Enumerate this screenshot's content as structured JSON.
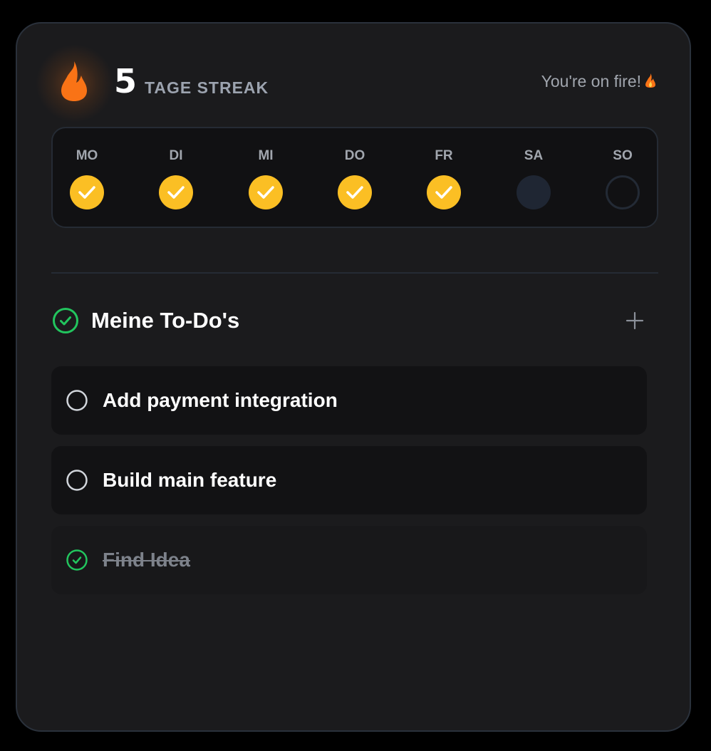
{
  "streak": {
    "count": "5",
    "label": "TAGE STREAK",
    "message": "You're on fire!",
    "icon": "flame-icon"
  },
  "week": {
    "days": [
      {
        "label": "MO",
        "status": "done"
      },
      {
        "label": "DI",
        "status": "done"
      },
      {
        "label": "MI",
        "status": "done"
      },
      {
        "label": "DO",
        "status": "done"
      },
      {
        "label": "FR",
        "status": "done"
      },
      {
        "label": "SA",
        "status": "rest"
      },
      {
        "label": "SO",
        "status": "open"
      }
    ]
  },
  "todos": {
    "title": "Meine To-Do's",
    "add_icon": "plus-icon",
    "items": [
      {
        "text": "Add payment integration",
        "done": false
      },
      {
        "text": "Build main feature",
        "done": false
      },
      {
        "text": "Find Idea",
        "done": true
      }
    ]
  },
  "colors": {
    "accent_yellow": "#fbbf24",
    "accent_green": "#22c55e",
    "flame_orange": "#f97316",
    "card_bg": "#1b1b1d"
  }
}
